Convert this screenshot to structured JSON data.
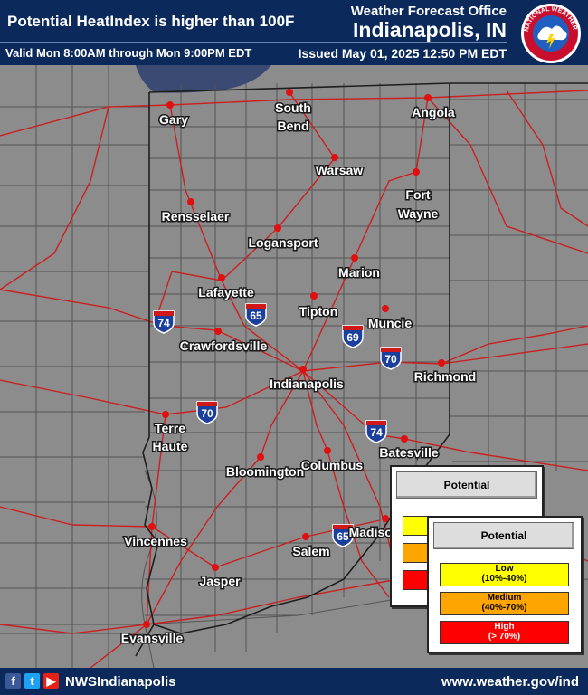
{
  "header": {
    "product_title": "Potential HeatIndex is higher than 100F",
    "valid_time": "Valid Mon 8:00AM through Mon 9:00PM EDT",
    "office_line": "Weather Forecast Office",
    "office_name": "Indianapolis, IN",
    "issued": "Issued May 01, 2025 12:50 PM EDT",
    "logo_text": "NATIONAL WEATHER SERVICE"
  },
  "footer": {
    "social_handle": "NWSIndianapolis",
    "website": "www.weather.gov/ind",
    "icons": [
      "facebook-icon",
      "twitter-icon",
      "youtube-icon"
    ]
  },
  "map": {
    "background_color": "#8c8c8c",
    "road_color": "#cc1f1f",
    "city_marker_color": "#e01010",
    "cities": [
      {
        "name": "Gary"
      },
      {
        "name": "South Bend"
      },
      {
        "name": "Angola"
      },
      {
        "name": "Warsaw"
      },
      {
        "name": "Fort Wayne"
      },
      {
        "name": "Rensselaer"
      },
      {
        "name": "Logansport"
      },
      {
        "name": "Marion"
      },
      {
        "name": "Lafayette"
      },
      {
        "name": "Tipton"
      },
      {
        "name": "Muncie"
      },
      {
        "name": "Crawfordsville"
      },
      {
        "name": "Indianapolis"
      },
      {
        "name": "Richmond"
      },
      {
        "name": "Terre Haute"
      },
      {
        "name": "Bloomington"
      },
      {
        "name": "Columbus"
      },
      {
        "name": "Batesville"
      },
      {
        "name": "Vincennes"
      },
      {
        "name": "Jasper"
      },
      {
        "name": "Salem"
      },
      {
        "name": "Madison"
      },
      {
        "name": "Evansville"
      }
    ],
    "interstates": [
      "74",
      "65",
      "69",
      "70",
      "70",
      "74",
      "65"
    ]
  },
  "legend": {
    "back_title": "Potential",
    "front_title": "Potential",
    "items": [
      {
        "label": "Low",
        "range": "(10%-40%)",
        "color": "#ffff00"
      },
      {
        "label": "Medium",
        "range": "(40%-70%)",
        "color": "#ffa500"
      },
      {
        "label": "High",
        "range": "(> 70%)",
        "color": "#ff0000"
      }
    ]
  }
}
